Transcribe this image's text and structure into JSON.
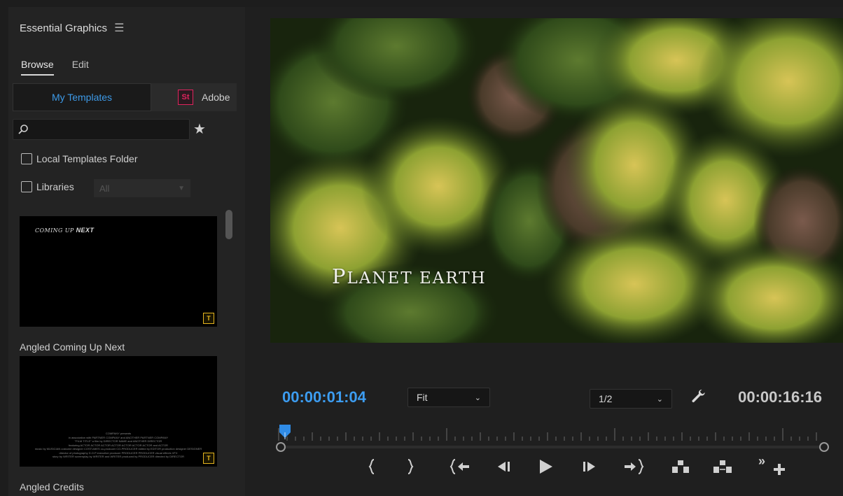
{
  "panel": {
    "title": "Essential Graphics",
    "menu_icon": "hamburger-icon",
    "tabs": [
      {
        "label": "Browse",
        "active": true
      },
      {
        "label": "Edit",
        "active": false
      }
    ],
    "source_tabs": {
      "my_templates": "My Templates",
      "adobe_stock_badge": "St",
      "adobe_stock": "Adobe"
    },
    "search": {
      "value": "",
      "placeholder": ""
    },
    "local_templates_label": "Local Templates Folder",
    "libraries_label": "Libraries",
    "libraries_select": "All",
    "templates": [
      {
        "name": "Angled Coming Up Next",
        "preview_text_a": "COMING UP ",
        "preview_text_b": "NEXT",
        "badge": "T"
      },
      {
        "name": "Angled Credits",
        "badge": "T",
        "credits_lines": [
          "COMPANY presents",
          "in association with PARTNER COMPANY and ANOTHER PARTNER COMPANY",
          "\"FILM TITLE\" a film by DIRECTOR NAME and ANOTHER DIRECTOR",
          "featuring ACTOR ACTOR ACTOR ACTOR ACTOR ACTOR ACTOR and ACTOR",
          "music by MUSICIAN costume designer COSTUMES co-producer CO-PRODUCER edited by EDITOR production designer DESIGNER",
          "director of photography D.O.P executive producer PRODUCER PRODUCER visual effects VFX",
          "story by WRITER screenplay by WRITER and WRITER produced by PRODUCER directed by DIRECTOR"
        ]
      }
    ]
  },
  "monitor": {
    "video_title_first": "P",
    "video_title_rest": "LANET EARTH",
    "timecode_current": "00:00:01:04",
    "timecode_total": "00:00:16:16",
    "zoom_select": "Fit",
    "resolution_select": "1/2",
    "current_color": "#3c9cf0"
  },
  "transport": [
    {
      "name": "mark-in-icon"
    },
    {
      "name": "mark-out-icon"
    },
    {
      "name": "go-to-in-icon"
    },
    {
      "name": "step-back-icon"
    },
    {
      "name": "play-icon"
    },
    {
      "name": "step-forward-icon"
    },
    {
      "name": "go-to-out-icon"
    },
    {
      "name": "lift-icon"
    },
    {
      "name": "extract-icon"
    },
    {
      "name": "more-controls-icon"
    },
    {
      "name": "add-button-icon"
    }
  ]
}
